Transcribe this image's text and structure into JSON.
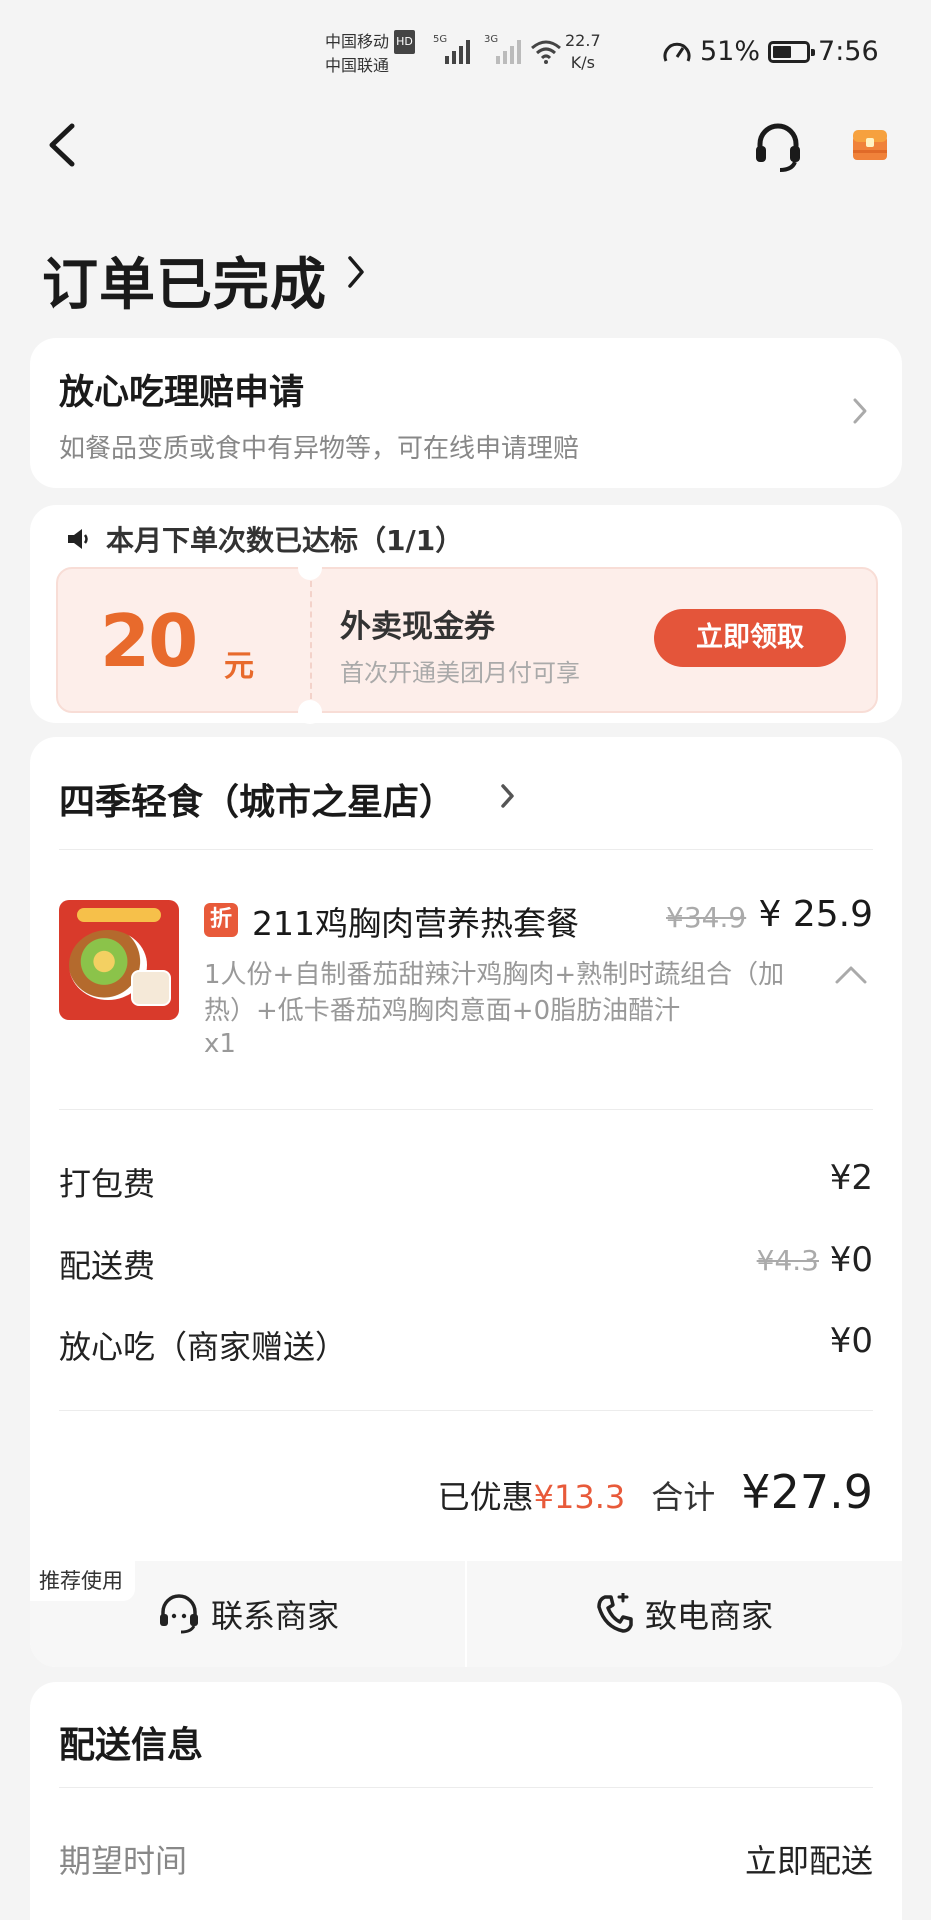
{
  "status_bar": {
    "carrier_1": "中国移动",
    "carrier_1_badge": "HD",
    "carrier_2": "中国联通",
    "net_1": "5G",
    "net_2": "3G",
    "speed_value": "22.7",
    "speed_unit": "K/s",
    "battery": "51%",
    "time": "7:56"
  },
  "header": {
    "status_title": "订单已完成"
  },
  "claim": {
    "title": "放心吃理赔申请",
    "description": "如餐品变质或食中有异物等，可在线申请理赔"
  },
  "promo": {
    "heading": "本月下单次数已达标（1/1）",
    "amount": "20",
    "unit": "元",
    "name": "外卖现金券",
    "subtitle": "首次开通美团月付可享",
    "button": "立即领取"
  },
  "order": {
    "shop_name": "四季轻食（城市之星店）",
    "item": {
      "badge": "折",
      "name": "211鸡胸肉营养热套餐",
      "original_price": "¥34.9",
      "price": "¥ 25.9",
      "description": "1人份+自制番茄甜辣汁鸡胸肉+熟制时蔬组合（加热）+低卡番茄鸡胸肉意面+0脂肪油醋汁",
      "quantity": "x1"
    },
    "fees": [
      {
        "label": "打包费",
        "value": "¥2"
      },
      {
        "label": "配送费",
        "original": "¥4.3",
        "value": "¥0"
      },
      {
        "label": "放心吃（商家赠送）",
        "value": "¥0"
      }
    ],
    "saved_label": "已优惠",
    "saved_value": "¥13.3",
    "total_label": "合计",
    "total_value": "¥27.9",
    "recommend_tag": "推荐使用",
    "contact_label": "联系商家",
    "call_label": "致电商家"
  },
  "delivery": {
    "title": "配送信息",
    "expected_label": "期望时间",
    "expected_value": "立即配送"
  }
}
